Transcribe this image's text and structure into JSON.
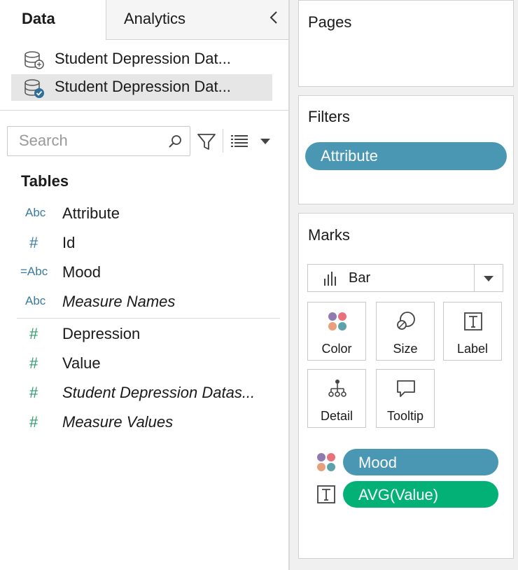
{
  "tabs": {
    "data": "Data",
    "analytics": "Analytics"
  },
  "data_sources": [
    {
      "label": "Student Depression Dat...",
      "icon": "database-link-icon",
      "selected": false
    },
    {
      "label": "Student Depression Dat...",
      "icon": "database-check-icon",
      "selected": true
    }
  ],
  "search": {
    "placeholder": "Search",
    "value": ""
  },
  "tables_header": "Tables",
  "dimensions": [
    {
      "type_label": "Abc",
      "name": "Attribute",
      "italic": false
    },
    {
      "type_label": "#",
      "name": "Id",
      "italic": false
    },
    {
      "type_label": "=Abc",
      "name": "Mood",
      "italic": false
    },
    {
      "type_label": "Abc",
      "name": "Measure Names",
      "italic": true
    }
  ],
  "measures": [
    {
      "type_label": "#",
      "name": "Depression",
      "italic": false
    },
    {
      "type_label": "#",
      "name": "Value",
      "italic": false
    },
    {
      "type_label": "#",
      "name": "Student Depression Datas...",
      "italic": true
    },
    {
      "type_label": "#",
      "name": "Measure Values",
      "italic": true
    }
  ],
  "pages": {
    "title": "Pages"
  },
  "filters": {
    "title": "Filters",
    "pills": [
      "Attribute"
    ]
  },
  "marks": {
    "title": "Marks",
    "mark_type": "Bar",
    "buttons": {
      "color": "Color",
      "size": "Size",
      "label": "Label",
      "detail": "Detail",
      "tooltip": "Tooltip"
    },
    "shelf": [
      {
        "field": "Mood",
        "encoding": "color",
        "color": "#4a97b4"
      },
      {
        "field": "AVG(Value)",
        "encoding": "label",
        "color": "#03b176"
      }
    ]
  },
  "colors": {
    "dimension_pill": "#4a97b4",
    "measure_pill": "#03b176",
    "selected_row": "#e6e6e6"
  }
}
